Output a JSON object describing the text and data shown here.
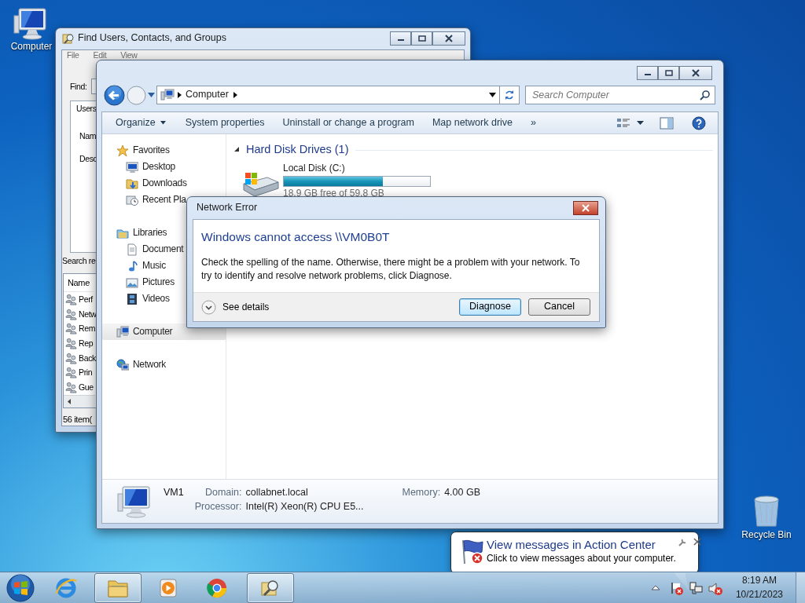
{
  "desktop_icons": [
    {
      "label": "Computer"
    },
    {
      "label": "Recycle Bin"
    }
  ],
  "find_window": {
    "title": "Find Users, Contacts, and Groups",
    "menu": [
      "File",
      "Edit",
      "View"
    ],
    "find_label": "Find:",
    "tab": "Users",
    "field_labels": [
      "Nam",
      "Desc"
    ],
    "results_label": "Search re",
    "list_column": "Name",
    "rows": [
      "Perf",
      "Netw",
      "Rem",
      "Rep",
      "Back",
      "Prin",
      "Gue"
    ],
    "status_bar": "56 item("
  },
  "explorer": {
    "address": [
      "Computer"
    ],
    "search": {
      "placeholder": "Search Computer"
    },
    "toolbar": [
      "Organize",
      "System properties",
      "Uninstall or change a program",
      "Map network drive"
    ],
    "toolbar_more": "»",
    "navigation": [
      {
        "label": "Favorites",
        "selected": false,
        "children": [
          {
            "label": "Desktop",
            "selected": false
          },
          {
            "label": "Downloads",
            "selected": false
          },
          {
            "label": "Recent Pla",
            "selected": false
          }
        ]
      },
      {
        "label": "Libraries",
        "selected": false,
        "children": [
          {
            "label": "Document",
            "selected": false
          },
          {
            "label": "Music",
            "selected": false
          },
          {
            "label": "Pictures",
            "selected": false
          },
          {
            "label": "Videos",
            "selected": false
          }
        ]
      },
      {
        "label": "Computer",
        "selected": true
      },
      {
        "label": "Network",
        "selected": false
      }
    ],
    "group": {
      "title": "Hard Disk Drives (1)",
      "expanded": true
    },
    "drives": [
      {
        "name": "Local Disk (C:)",
        "level": 0.68,
        "free": "18.9 GB free of 59.8 GB"
      }
    ],
    "details": {
      "name": "VM1",
      "fields": [
        {
          "label": "Domain:",
          "value": "collabnet.local"
        },
        {
          "label": "Memory:",
          "value": "4.00 GB"
        },
        {
          "label": "Processor:",
          "value": "Intel(R) Xeon(R) CPU E5..."
        }
      ]
    }
  },
  "dialog": {
    "title": "Network Error",
    "heading": "Windows cannot access \\\\VM0B0T",
    "message": "Check the spelling of the name. Otherwise, there might be a problem with your network. To try to identify and resolve network problems, click Diagnose.",
    "details_toggle": "See details",
    "buttons": [
      {
        "label": "Diagnose",
        "default": true
      },
      {
        "label": "Cancel",
        "default": false
      }
    ]
  },
  "notification": {
    "title": "View messages in Action Center",
    "text": "Click to view messages about your computer."
  },
  "taskbar": {
    "items": [
      {
        "kind": "ie",
        "active": false
      },
      {
        "kind": "folder",
        "active": true
      },
      {
        "kind": "media",
        "active": false
      },
      {
        "kind": "chrome",
        "active": false
      },
      {
        "kind": "search",
        "active": true
      }
    ],
    "time": "8:19 AM",
    "date": "10/21/2023"
  }
}
